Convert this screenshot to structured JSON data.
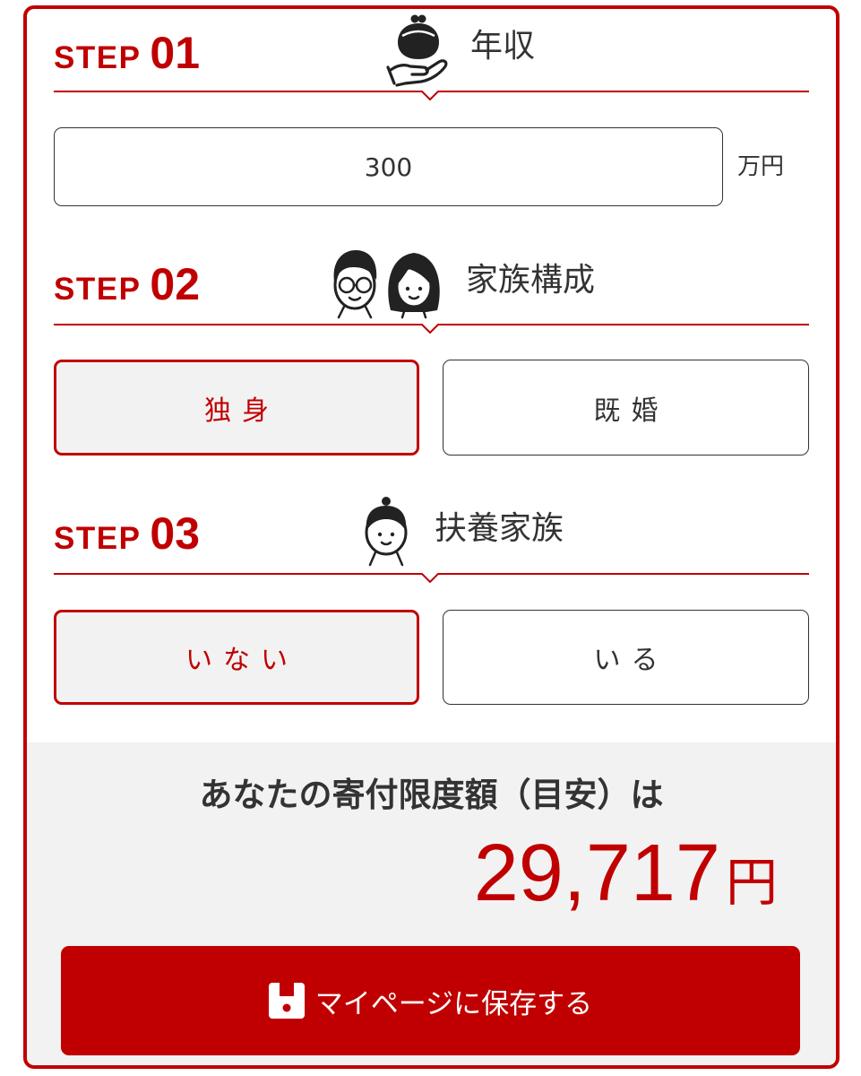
{
  "colors": {
    "accent": "#c00000",
    "text": "#333333",
    "border": "#333333",
    "selected_bg": "#f2f2f2",
    "result_bg": "#f2f2f2"
  },
  "steps": [
    {
      "label": "STEP",
      "number": "01",
      "title": "年収",
      "icon": "hand-holding-purse-icon"
    },
    {
      "label": "STEP",
      "number": "02",
      "title": "家族構成",
      "icon": "couple-faces-icon"
    },
    {
      "label": "STEP",
      "number": "03",
      "title": "扶養家族",
      "icon": "child-face-icon"
    }
  ],
  "income": {
    "value": "300",
    "unit": "万円"
  },
  "family": {
    "options": [
      "独身",
      "既婚"
    ],
    "selected_index": 0
  },
  "dependents": {
    "options": [
      "いない",
      "いる"
    ],
    "selected_index": 0
  },
  "result": {
    "label": "あなたの寄付限度額（目安）は",
    "amount": "29,717",
    "unit": "円"
  },
  "save_button": {
    "label": "マイページに保存する",
    "icon": "save-icon"
  }
}
